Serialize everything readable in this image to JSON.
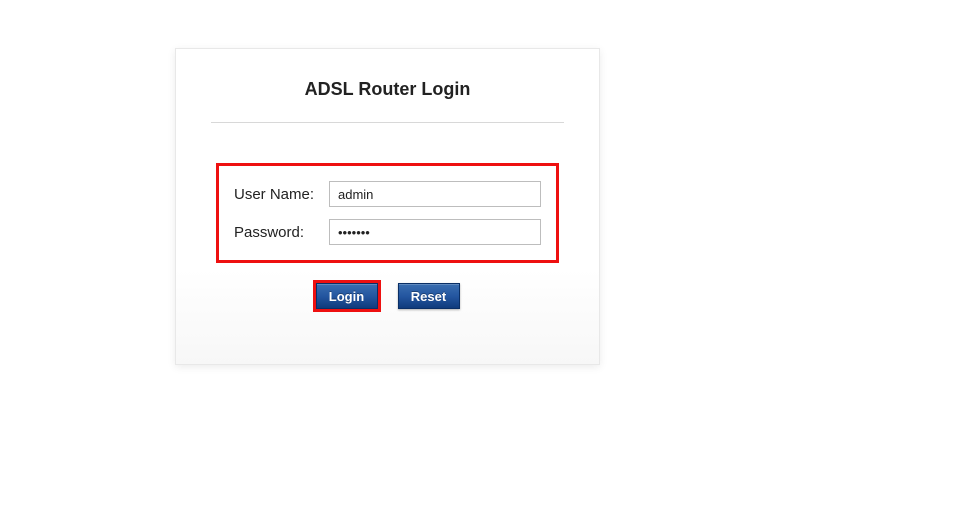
{
  "login": {
    "title": "ADSL Router Login",
    "username_label": "User Name:",
    "username_value": "admin",
    "password_label": "Password:",
    "password_value": "•••••••",
    "login_button": "Login",
    "reset_button": "Reset"
  }
}
